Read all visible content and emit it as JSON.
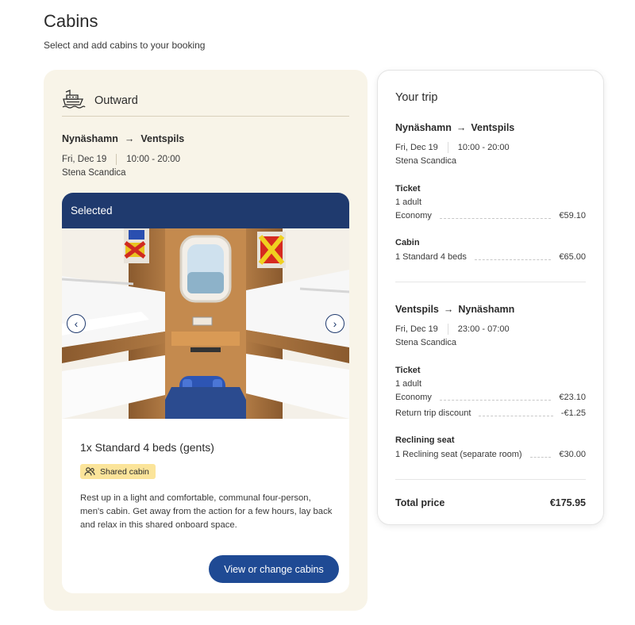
{
  "page": {
    "title": "Cabins",
    "subtitle": "Select and add cabins to your booking"
  },
  "outward": {
    "label": "Outward",
    "from": "Nynäshamn",
    "to": "Ventspils",
    "date": "Fri, Dec 19",
    "time": "10:00 - 20:00",
    "ship": "Stena Scandica",
    "cabin_card": {
      "selected_label": "Selected",
      "name": "1x Standard 4 beds (gents)",
      "badge": "Shared cabin",
      "description": "Rest up in a light and comfortable, communal four-person, men's cabin. Get away from the action for a few hours, lay back and relax in this shared onboard space.",
      "button": "View or change cabins",
      "prev_icon": "‹",
      "next_icon": "›"
    }
  },
  "trip": {
    "title": "Your trip",
    "outbound": {
      "from": "Nynäshamn",
      "to": "Ventspils",
      "date": "Fri, Dec 19",
      "time": "10:00 - 20:00",
      "ship": "Stena Scandica",
      "ticket_heading": "Ticket",
      "ticket_pax": "1 adult",
      "ticket_class": "Economy",
      "ticket_price": "€59.10",
      "cabin_heading": "Cabin",
      "cabin_item": "1 Standard 4 beds",
      "cabin_price": "€65.00"
    },
    "return": {
      "from": "Ventspils",
      "to": "Nynäshamn",
      "date": "Fri, Dec 19",
      "time": "23:00 - 07:00",
      "ship": "Stena Scandica",
      "ticket_heading": "Ticket",
      "ticket_pax": "1 adult",
      "ticket_class": "Economy",
      "ticket_price": "€23.10",
      "discount_label": "Return trip discount",
      "discount_price": "-€1.25",
      "seat_heading": "Reclining seat",
      "seat_item": "1 Reclining seat (separate room)",
      "seat_price": "€30.00"
    },
    "total_label": "Total price",
    "total_price": "€175.95"
  },
  "colors": {
    "navy": "#1f3a6e",
    "button_blue": "#1f4a94",
    "panel_cream": "#f8f4e8",
    "badge_yellow": "#fbe49a"
  },
  "icons": {
    "ship": "ferry-icon",
    "arrow": "arrow-right-icon",
    "people": "people-icon",
    "prev": "chevron-left-icon",
    "next": "chevron-right-icon"
  }
}
